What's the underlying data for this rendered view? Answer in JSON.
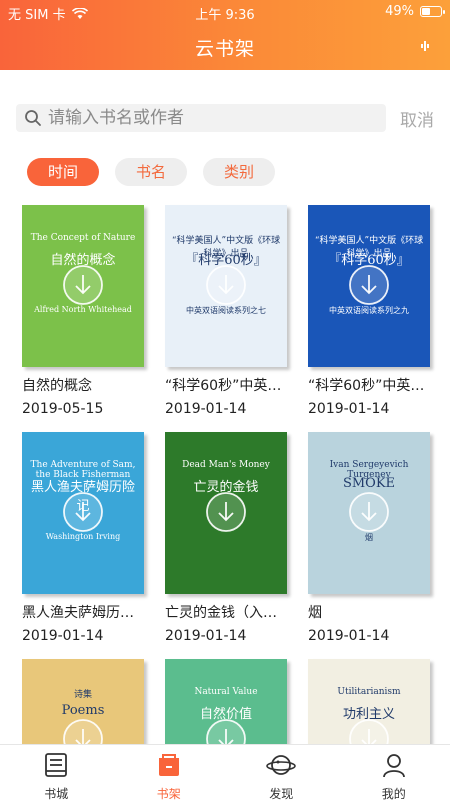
{
  "status_bar": {
    "carrier": "无 SIM 卡",
    "time": "上午 9:36",
    "battery": "49%",
    "battery_level": 0.49
  },
  "header": {
    "title": "云书架"
  },
  "search": {
    "placeholder": "请输入书名或作者",
    "cancel_label": "取消"
  },
  "filters": [
    {
      "label": "时间",
      "active": true
    },
    {
      "label": "书名",
      "active": false
    },
    {
      "label": "类别",
      "active": false
    }
  ],
  "books": [
    {
      "title": "自然的概念",
      "date": "2019-05-15",
      "cover_lines": [
        "The Concept of Nature",
        "自然的概念",
        "Alfred North Whitehead"
      ],
      "cover_color": "#7cc14a"
    },
    {
      "title": "“科学60秒”中英…",
      "date": "2019-01-14",
      "cover_lines": [
        "“科学美国人”中文版《环球科学》出品",
        "『科学60秒』",
        "中英双语阅读系列之七"
      ],
      "cover_color": "#e8f0f8"
    },
    {
      "title": "“科学60秒”中英…",
      "date": "2019-01-14",
      "cover_lines": [
        "“科学美国人”中文版《环球科学》出品",
        "『科学60秒』",
        "中英双语阅读系列之九"
      ],
      "cover_color": "#1a56b8"
    },
    {
      "title": "黑人渔夫萨姆历险记",
      "date": "2019-01-14",
      "cover_lines": [
        "The Adventure of Sam, the Black Fisherman",
        "黑人渔夫萨姆历险记",
        "Washington Irving"
      ],
      "cover_color": "#3aa6d8"
    },
    {
      "title": "亡灵的金钱（入门…",
      "date": "2019-01-14",
      "cover_lines": [
        "Dead Man's Money",
        "亡灵的金钱"
      ],
      "cover_color": "#2d7a2a"
    },
    {
      "title": "烟",
      "date": "2019-01-14",
      "cover_lines": [
        "Ivan Sergeyevich Turgenev",
        "SMOKE",
        "烟"
      ],
      "cover_color": "#b9d3dd"
    },
    {
      "title": "",
      "date": "",
      "cover_lines": [
        "诗集",
        "Poems"
      ],
      "cover_color": "#e8c77a"
    },
    {
      "title": "",
      "date": "",
      "cover_lines": [
        "Natural Value",
        "自然价值"
      ],
      "cover_color": "#5bbd8e"
    },
    {
      "title": "",
      "date": "",
      "cover_lines": [
        "Utilitarianism",
        "功利主义"
      ],
      "cover_color": "#f2efe2"
    }
  ],
  "tabbar": [
    {
      "label": "书城",
      "icon": "bookstore-icon",
      "active": false
    },
    {
      "label": "书架",
      "icon": "bookshelf-icon",
      "active": true
    },
    {
      "label": "发现",
      "icon": "discover-icon",
      "active": false
    },
    {
      "label": "我的",
      "icon": "profile-icon",
      "active": false
    }
  ],
  "colors": {
    "accent": "#f9643a",
    "accent_light": "#fca03a"
  }
}
